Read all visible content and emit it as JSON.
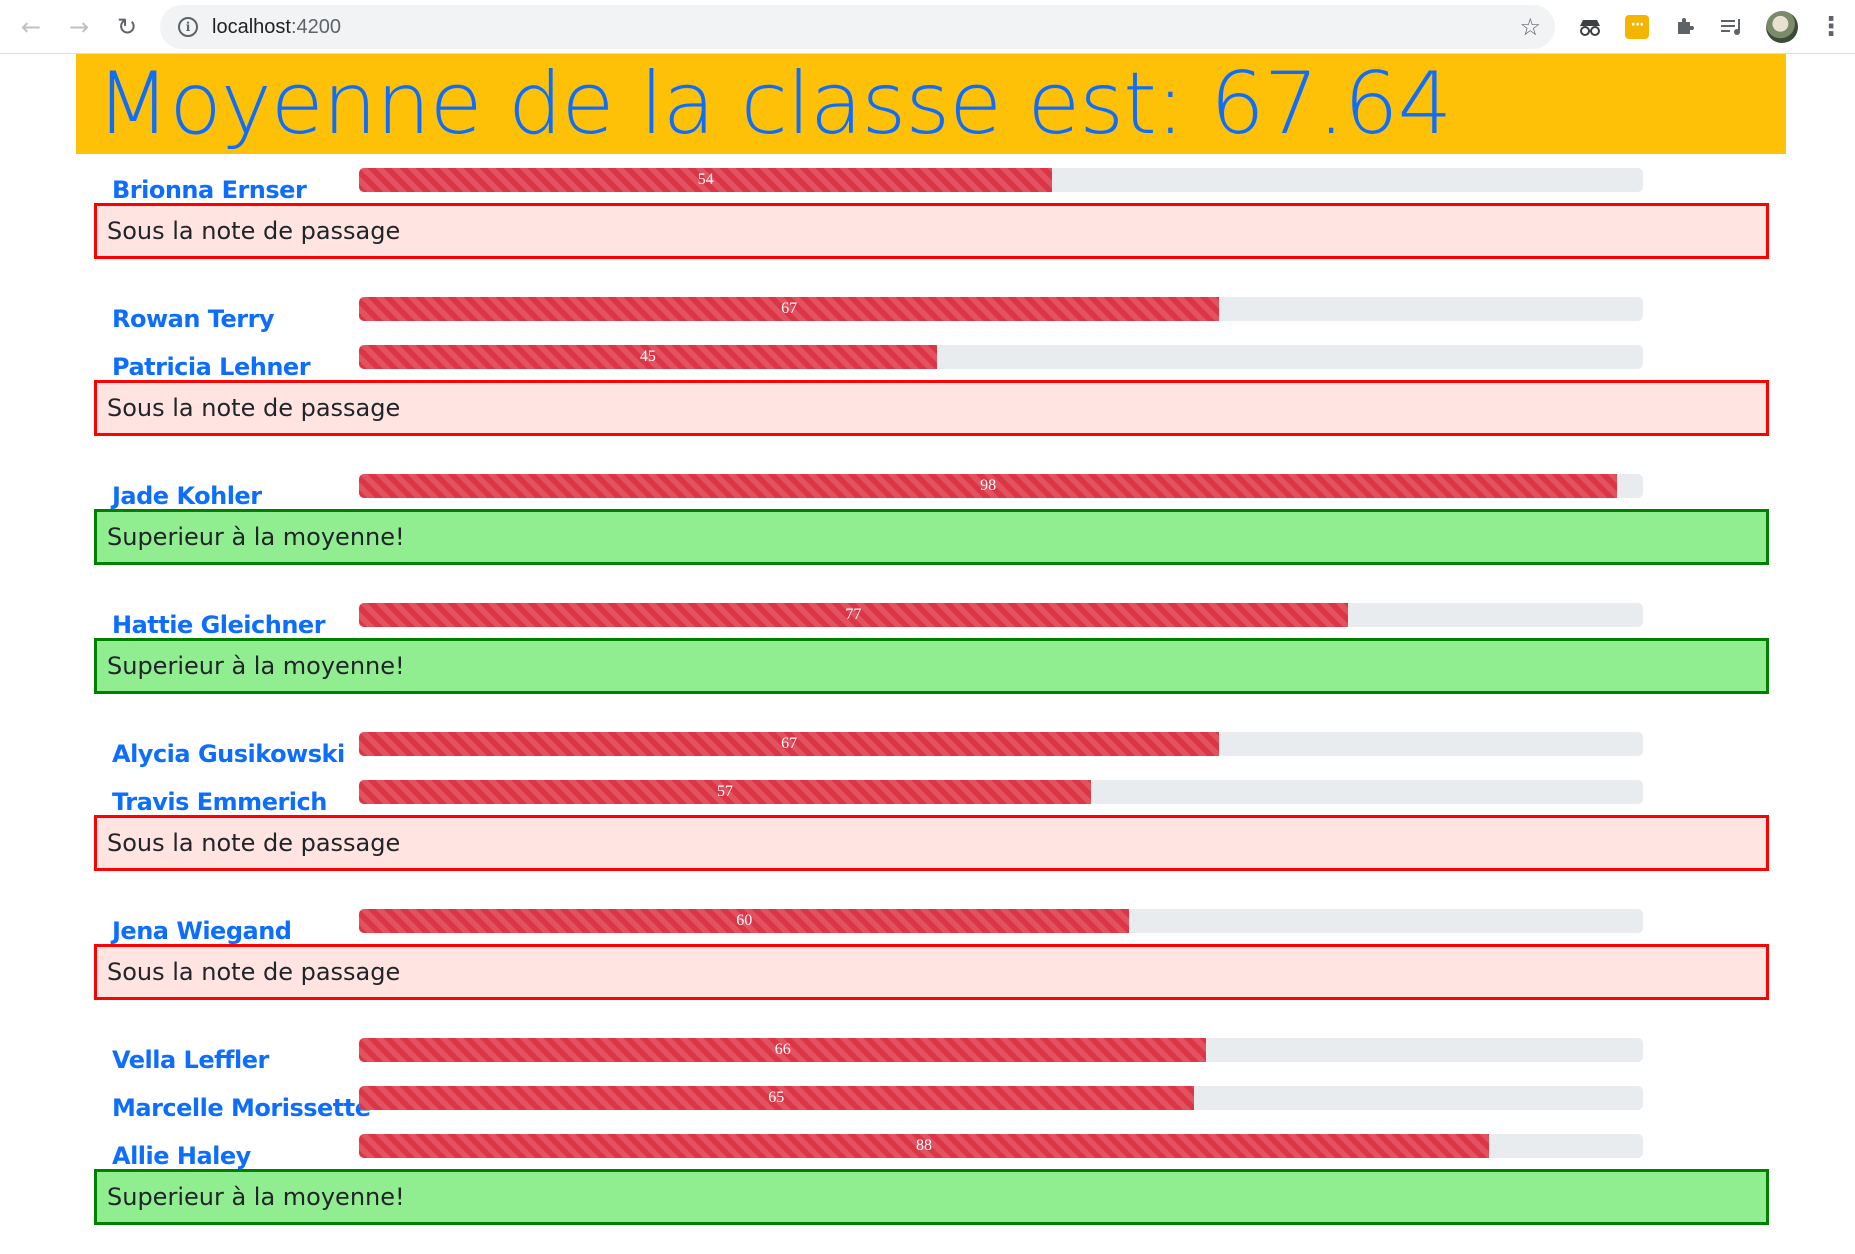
{
  "browser": {
    "url_host": "localhost",
    "url_port": ":4200",
    "icons": {
      "back": "arrow-left-icon",
      "forward": "arrow-right-icon",
      "reload": "reload-icon",
      "info": "info-icon",
      "star": "star-icon",
      "extension_1": "incognito-extension-icon",
      "extension_2": "ellipsis-extension-icon",
      "extensions": "puzzle-icon",
      "media": "media-queue-icon",
      "menu": "vertical-dots-icon"
    }
  },
  "page": {
    "title": "Moyenne de la classe est: 67.64"
  },
  "students": [
    {
      "name": "Brionna Ernser",
      "score": 54,
      "score_label": "54"
    },
    {
      "name": "Rowan Terry",
      "score": 67,
      "score_label": "67"
    },
    {
      "name": "Patricia Lehner",
      "score": 45,
      "score_label": "45"
    },
    {
      "name": "Jade Kohler",
      "score": 98,
      "score_label": "98"
    },
    {
      "name": "Hattie Gleichner",
      "score": 77,
      "score_label": "77"
    },
    {
      "name": "Alycia Gusikowski",
      "score": 67,
      "score_label": "67"
    },
    {
      "name": "Travis Emmerich",
      "score": 57,
      "score_label": "57"
    },
    {
      "name": "Jena Wiegand",
      "score": 60,
      "score_label": "60"
    },
    {
      "name": "Vella Leffler",
      "score": 66,
      "score_label": "66"
    },
    {
      "name": "Marcelle Morissette",
      "score": 65,
      "score_label": "65"
    },
    {
      "name": "Allie Haley",
      "score": 88,
      "score_label": "88"
    }
  ],
  "statuses": [
    {
      "text": "Sous la note de passage",
      "kind": "fail"
    },
    {
      "text": "Sous la note de passage",
      "kind": "fail"
    },
    {
      "text": "Superieur à la moyenne!",
      "kind": "pass"
    },
    {
      "text": "Superieur à la moyenne!",
      "kind": "pass"
    },
    {
      "text": "Sous la note de passage",
      "kind": "fail"
    },
    {
      "text": "Sous la note de passage",
      "kind": "fail"
    },
    {
      "text": "Superieur à la moyenne!",
      "kind": "pass"
    }
  ],
  "colors": {
    "header_bg": "#ffc107",
    "title": "#0d6efd",
    "bar_fill": "#dc3545",
    "bar_track": "#e9ecef",
    "fail_bg": "#ffe4e1",
    "fail_border": "#ff0000",
    "pass_bg": "#90ee90",
    "pass_border": "#008000"
  }
}
